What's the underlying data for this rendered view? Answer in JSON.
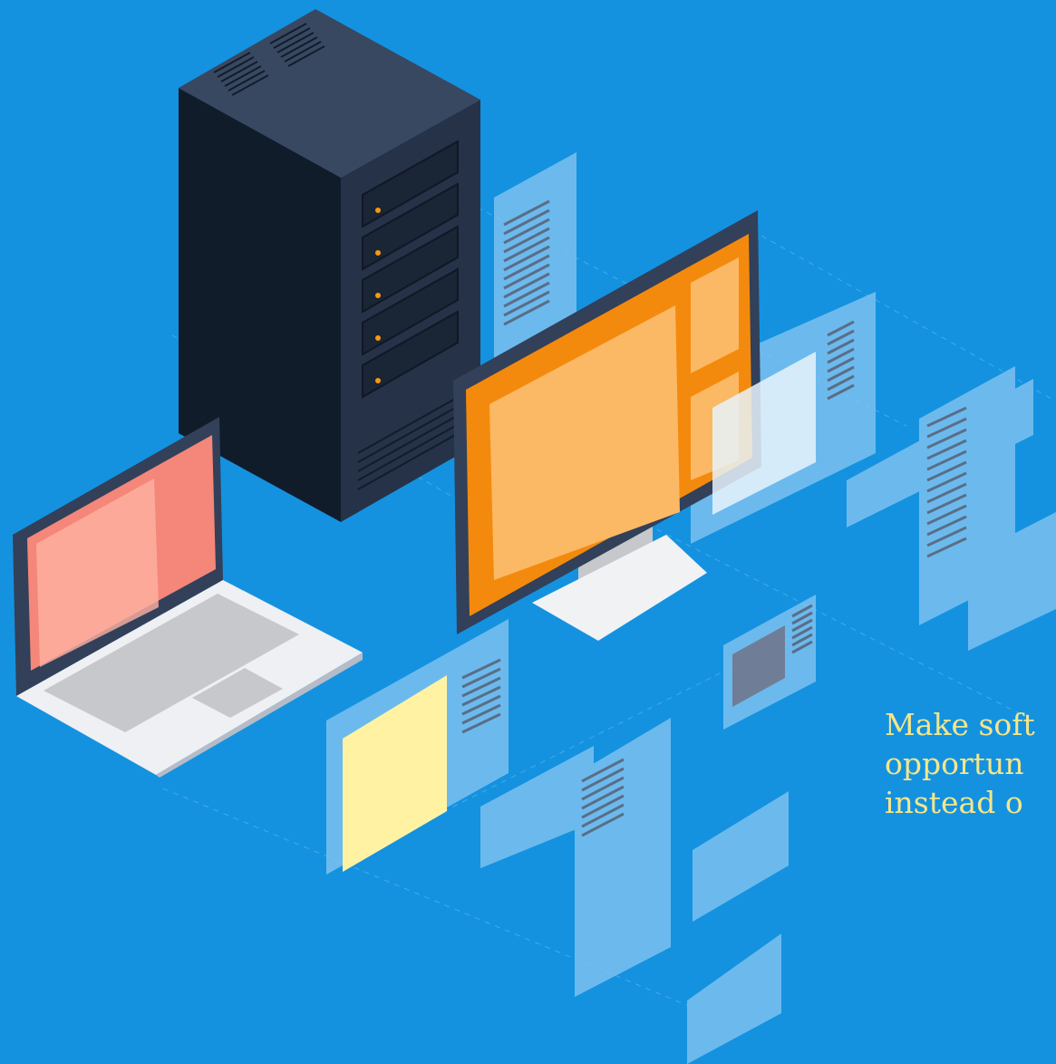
{
  "colors": {
    "background": "#1492e0",
    "panel": "#7cc2ef",
    "server_front": "#263247",
    "server_side": "#111c2b",
    "server_top": "#394861",
    "server_led": "#f59a0f",
    "laptop_screen": "#f4877a",
    "monitor_screen": "#f48a0d",
    "monitor_tile": "#fbb965",
    "sticky_note": "#fff3a3",
    "small_tile": "#6f7e96",
    "tagline": "#f4e68a"
  },
  "tagline": {
    "lines": [
      "Make soft",
      "opportun",
      "instead o"
    ]
  }
}
